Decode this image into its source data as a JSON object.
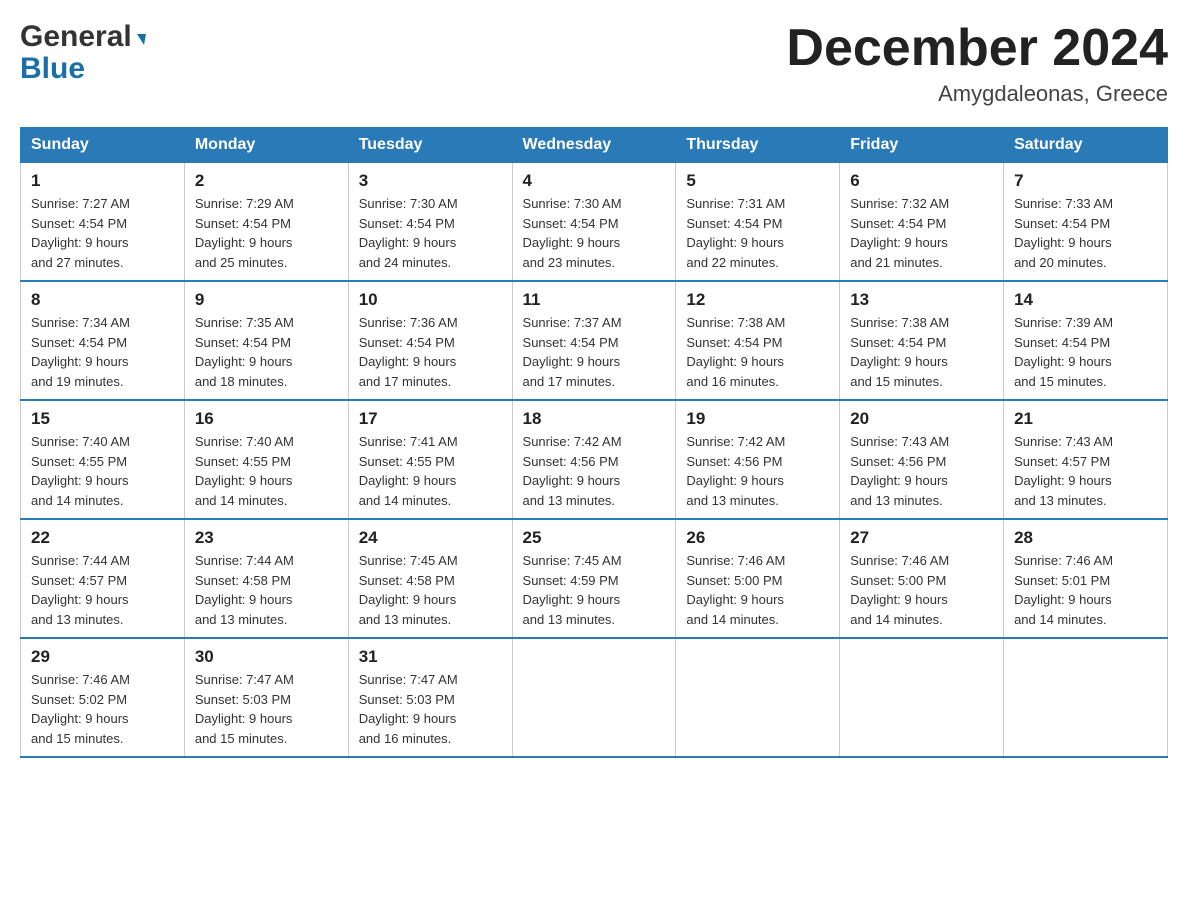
{
  "header": {
    "logo_line1": "General",
    "logo_line2": "Blue",
    "month_title": "December 2024",
    "location": "Amygdaleonas, Greece"
  },
  "days_of_week": [
    "Sunday",
    "Monday",
    "Tuesday",
    "Wednesday",
    "Thursday",
    "Friday",
    "Saturday"
  ],
  "weeks": [
    [
      {
        "day": "1",
        "sunrise": "7:27 AM",
        "sunset": "4:54 PM",
        "daylight": "9 hours and 27 minutes."
      },
      {
        "day": "2",
        "sunrise": "7:29 AM",
        "sunset": "4:54 PM",
        "daylight": "9 hours and 25 minutes."
      },
      {
        "day": "3",
        "sunrise": "7:30 AM",
        "sunset": "4:54 PM",
        "daylight": "9 hours and 24 minutes."
      },
      {
        "day": "4",
        "sunrise": "7:30 AM",
        "sunset": "4:54 PM",
        "daylight": "9 hours and 23 minutes."
      },
      {
        "day": "5",
        "sunrise": "7:31 AM",
        "sunset": "4:54 PM",
        "daylight": "9 hours and 22 minutes."
      },
      {
        "day": "6",
        "sunrise": "7:32 AM",
        "sunset": "4:54 PM",
        "daylight": "9 hours and 21 minutes."
      },
      {
        "day": "7",
        "sunrise": "7:33 AM",
        "sunset": "4:54 PM",
        "daylight": "9 hours and 20 minutes."
      }
    ],
    [
      {
        "day": "8",
        "sunrise": "7:34 AM",
        "sunset": "4:54 PM",
        "daylight": "9 hours and 19 minutes."
      },
      {
        "day": "9",
        "sunrise": "7:35 AM",
        "sunset": "4:54 PM",
        "daylight": "9 hours and 18 minutes."
      },
      {
        "day": "10",
        "sunrise": "7:36 AM",
        "sunset": "4:54 PM",
        "daylight": "9 hours and 17 minutes."
      },
      {
        "day": "11",
        "sunrise": "7:37 AM",
        "sunset": "4:54 PM",
        "daylight": "9 hours and 17 minutes."
      },
      {
        "day": "12",
        "sunrise": "7:38 AM",
        "sunset": "4:54 PM",
        "daylight": "9 hours and 16 minutes."
      },
      {
        "day": "13",
        "sunrise": "7:38 AM",
        "sunset": "4:54 PM",
        "daylight": "9 hours and 15 minutes."
      },
      {
        "day": "14",
        "sunrise": "7:39 AM",
        "sunset": "4:54 PM",
        "daylight": "9 hours and 15 minutes."
      }
    ],
    [
      {
        "day": "15",
        "sunrise": "7:40 AM",
        "sunset": "4:55 PM",
        "daylight": "9 hours and 14 minutes."
      },
      {
        "day": "16",
        "sunrise": "7:40 AM",
        "sunset": "4:55 PM",
        "daylight": "9 hours and 14 minutes."
      },
      {
        "day": "17",
        "sunrise": "7:41 AM",
        "sunset": "4:55 PM",
        "daylight": "9 hours and 14 minutes."
      },
      {
        "day": "18",
        "sunrise": "7:42 AM",
        "sunset": "4:56 PM",
        "daylight": "9 hours and 13 minutes."
      },
      {
        "day": "19",
        "sunrise": "7:42 AM",
        "sunset": "4:56 PM",
        "daylight": "9 hours and 13 minutes."
      },
      {
        "day": "20",
        "sunrise": "7:43 AM",
        "sunset": "4:56 PM",
        "daylight": "9 hours and 13 minutes."
      },
      {
        "day": "21",
        "sunrise": "7:43 AM",
        "sunset": "4:57 PM",
        "daylight": "9 hours and 13 minutes."
      }
    ],
    [
      {
        "day": "22",
        "sunrise": "7:44 AM",
        "sunset": "4:57 PM",
        "daylight": "9 hours and 13 minutes."
      },
      {
        "day": "23",
        "sunrise": "7:44 AM",
        "sunset": "4:58 PM",
        "daylight": "9 hours and 13 minutes."
      },
      {
        "day": "24",
        "sunrise": "7:45 AM",
        "sunset": "4:58 PM",
        "daylight": "9 hours and 13 minutes."
      },
      {
        "day": "25",
        "sunrise": "7:45 AM",
        "sunset": "4:59 PM",
        "daylight": "9 hours and 13 minutes."
      },
      {
        "day": "26",
        "sunrise": "7:46 AM",
        "sunset": "5:00 PM",
        "daylight": "9 hours and 14 minutes."
      },
      {
        "day": "27",
        "sunrise": "7:46 AM",
        "sunset": "5:00 PM",
        "daylight": "9 hours and 14 minutes."
      },
      {
        "day": "28",
        "sunrise": "7:46 AM",
        "sunset": "5:01 PM",
        "daylight": "9 hours and 14 minutes."
      }
    ],
    [
      {
        "day": "29",
        "sunrise": "7:46 AM",
        "sunset": "5:02 PM",
        "daylight": "9 hours and 15 minutes."
      },
      {
        "day": "30",
        "sunrise": "7:47 AM",
        "sunset": "5:03 PM",
        "daylight": "9 hours and 15 minutes."
      },
      {
        "day": "31",
        "sunrise": "7:47 AM",
        "sunset": "5:03 PM",
        "daylight": "9 hours and 16 minutes."
      },
      null,
      null,
      null,
      null
    ]
  ],
  "labels": {
    "sunrise": "Sunrise:",
    "sunset": "Sunset:",
    "daylight": "Daylight:"
  }
}
